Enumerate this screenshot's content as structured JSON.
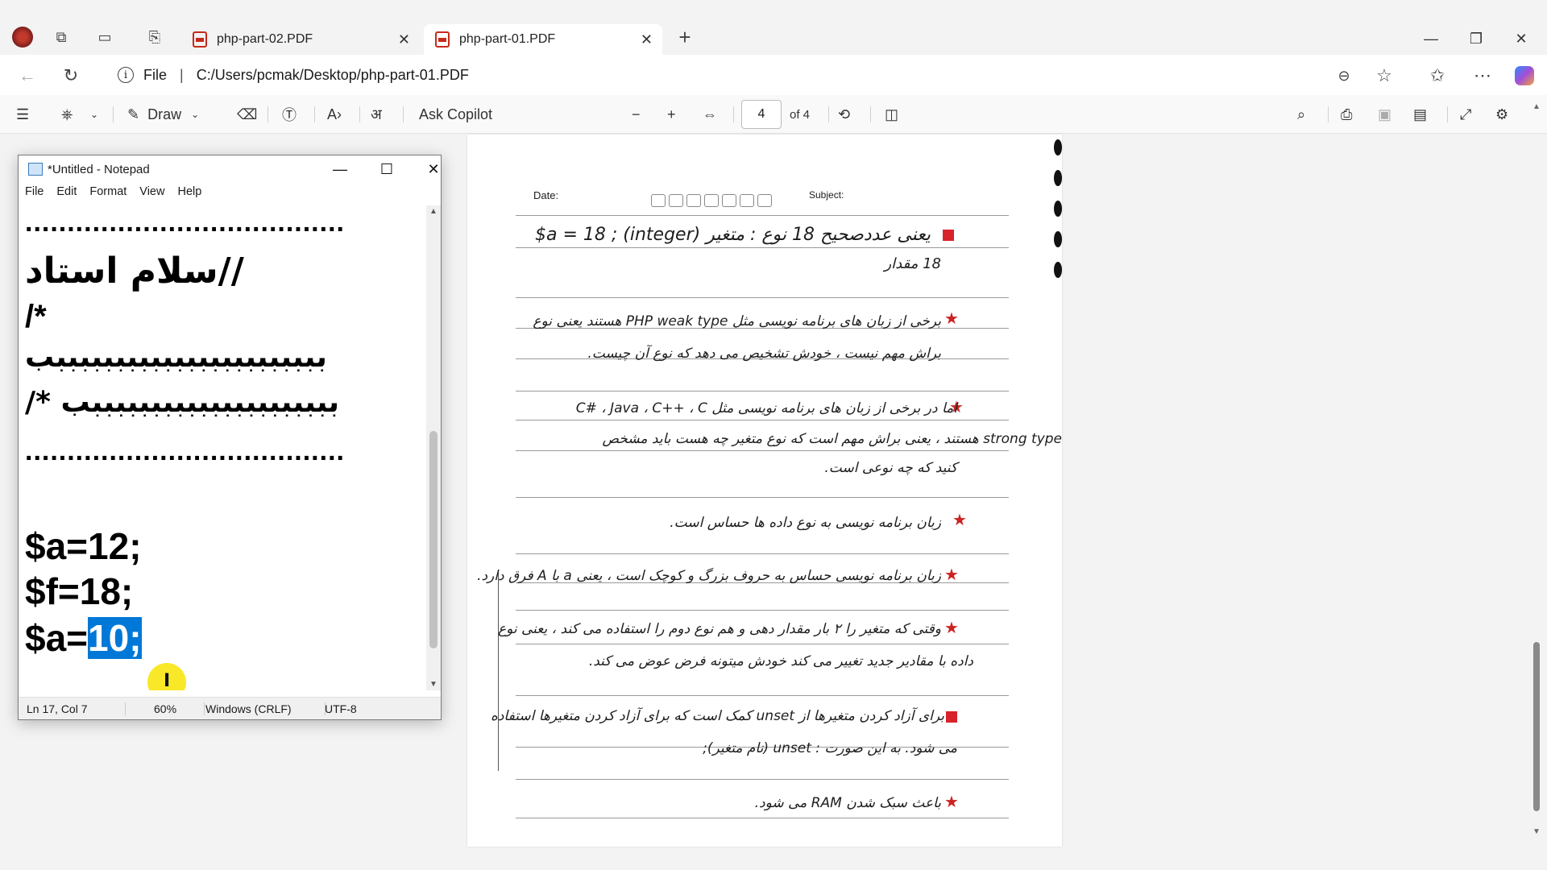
{
  "browser": {
    "tabs": [
      {
        "label": "php-part-02.PDF",
        "active": false
      },
      {
        "label": "php-part-01.PDF",
        "active": true
      }
    ],
    "new_tab": "+",
    "address": {
      "scheme_label": "File",
      "path": "C:/Users/pcmak/Desktop/php-part-01.PDF"
    }
  },
  "pdf_toolbar": {
    "draw_label": "Draw",
    "ask_copilot_label": "Ask Copilot",
    "page_current": "4",
    "page_total_label": "of 4"
  },
  "pdf_page": {
    "date_label": "Date:",
    "subject_label": "Subject:",
    "lines": [
      {
        "text": "$a = 18 ;   (integer) یعنی عددصحیح 18   نوع :   متغیر",
        "dir": "ltr"
      },
      {
        "text": "18 مقدار",
        "dir": "rtl"
      },
      {
        "text": "برخی از زبان های برنامه نویسی مثل  PHP  weak type  هستند یعنی نوع",
        "dir": "rtl"
      },
      {
        "text": "براش مهم نیست ، خودش تشخیص می دهد که نوع آن چیست.",
        "dir": "rtl"
      },
      {
        "text": "اما در برخی از زبان های برنامه نویسی مثل  C#  ،  Java  ،  C++  ،  C",
        "dir": "rtl"
      },
      {
        "text": "strong type  هستند ، یعنی براش مهم است که نوع متغیر چه هست باید مشخص",
        "dir": "rtl"
      },
      {
        "text": "کنید که چه نوعی است.",
        "dir": "rtl"
      },
      {
        "text": "زبان برنامه نویسی به نوع داده ها حساس است.",
        "dir": "rtl"
      },
      {
        "text": "زبان برنامه نویسی حساس به حروف بزرگ و کوچک است ، یعنی a با A فرق دارد.",
        "dir": "rtl"
      },
      {
        "text": "وقتی که متغیر را ۲ بار مقدار دهی و هم نوع دوم را استفاده می کند ، یعنی نوع",
        "dir": "rtl"
      },
      {
        "text": "داده با مقادیر جدید تغییر می کند خودش میتونه فرض عوض می کند.",
        "dir": "rtl"
      },
      {
        "text": "برای آزاد کردن متغیرها از unset کمک است که برای آزاد کردن متغیرها استفاده",
        "dir": "rtl"
      },
      {
        "text": "می شود. به این صورت :  unset (نام متغیر);",
        "dir": "rtl"
      },
      {
        "text": "باعث سبک شدن RAM می شود.",
        "dir": "rtl"
      }
    ]
  },
  "notepad": {
    "title": "*Untitled - Notepad",
    "menu": [
      "File",
      "Edit",
      "Format",
      "View",
      "Help"
    ],
    "lines": {
      "dots1": "......................................",
      "comment_line": "سلام استاد//",
      "open_comment": "/*",
      "b_line1": "بببببببببببببببببببببببب",
      "b_line2": "بببببببببببببببببببببب */",
      "dots2": "......................................",
      "code1": "$a=12;",
      "code2": "$f=18;",
      "code3_prefix": "$a=",
      "code3_selected": "10;"
    },
    "status": {
      "position": "Ln 17, Col 7",
      "zoom": "60%",
      "line_ending": "Windows (CRLF)",
      "encoding": "UTF-8"
    }
  }
}
